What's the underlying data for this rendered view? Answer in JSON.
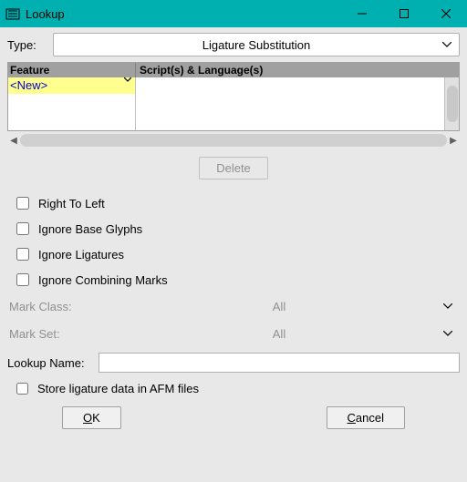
{
  "window": {
    "title": "Lookup"
  },
  "type": {
    "label": "Type:",
    "value": "Ligature Substitution"
  },
  "table": {
    "header_feature": "Feature",
    "header_scripts": "Script(s) & Language(s)",
    "new_label": "<New>"
  },
  "buttons": {
    "delete": "Delete",
    "ok_prefix": "O",
    "ok_rest": "K",
    "cancel_prefix": "C",
    "cancel_rest": "ancel"
  },
  "checks": {
    "rtl": "Right To Left",
    "ignore_base": "Ignore Base Glyphs",
    "ignore_liga": "Ignore Ligatures",
    "ignore_marks": "Ignore Combining Marks"
  },
  "mark_class": {
    "label": "Mark Class:",
    "value": "All"
  },
  "mark_set": {
    "label": "Mark Set:",
    "value": "All"
  },
  "lookup": {
    "label": "Lookup Name:",
    "value": ""
  },
  "store": {
    "label": "Store ligature data in AFM files"
  }
}
